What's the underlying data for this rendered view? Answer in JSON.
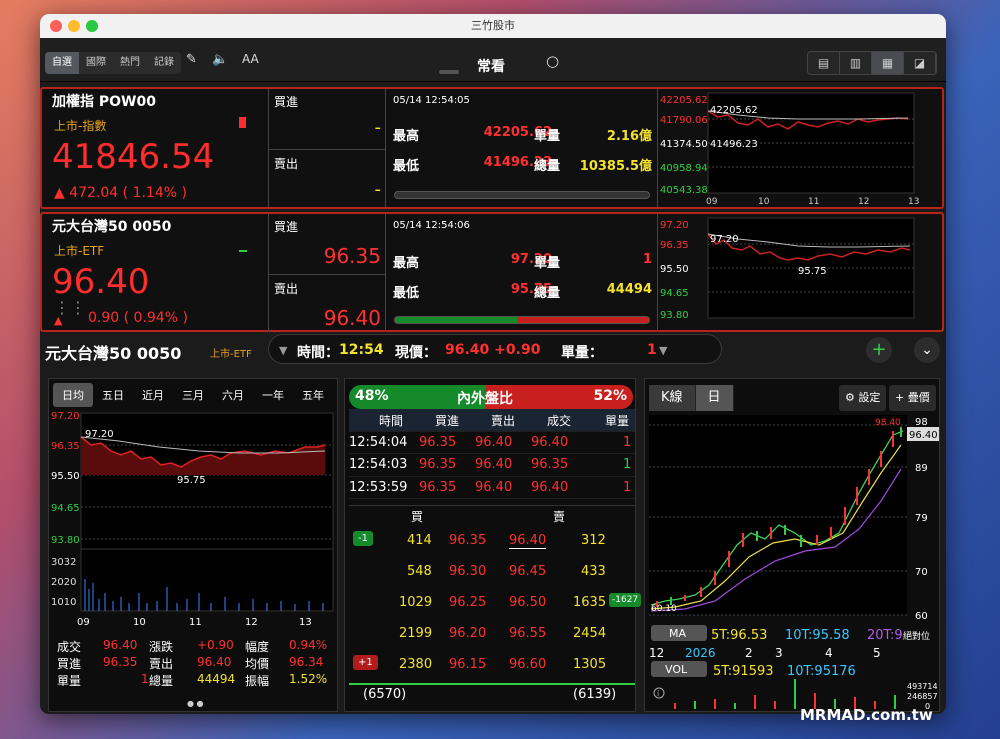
{
  "window": {
    "title": "三竹股市"
  },
  "toolbar": {
    "segments": [
      "自選",
      "國際",
      "熱門",
      "記錄"
    ],
    "center_title": "常看",
    "font_btn": "AA"
  },
  "quotes": [
    {
      "name": "加權指 POW00",
      "sub": "上市-指數",
      "price": "41846.54",
      "change": "▲  472.04  ( 1.14% )",
      "bid_label": "買進",
      "ask_label": "賣出",
      "bid": "-",
      "ask": "-",
      "time": "05/14 12:54:05",
      "high_label": "最高",
      "high": "42205.62",
      "low_label": "最低",
      "low": "41496.23",
      "unit_label": "單量",
      "unit": "2.16億",
      "total_label": "總量",
      "total": "10385.5億",
      "chart": {
        "y": [
          "42205.62",
          "41790.06",
          "41374.50",
          "40958.94",
          "40543.38"
        ],
        "hi": "42205.62",
        "mid": "41374.50",
        "lo": "41496.23",
        "x": [
          "09",
          "10",
          "11",
          "12",
          "13"
        ]
      }
    },
    {
      "name": "元大台灣50 0050",
      "sub": "上市-ETF",
      "price": "96.40",
      "change": "0.90  ( 0.94% )",
      "bid_label": "買進",
      "ask_label": "賣出",
      "bid": "96.35",
      "ask": "96.40",
      "time": "05/14 12:54:06",
      "high_label": "最高",
      "high": "97.20",
      "low_label": "最低",
      "low": "95.75",
      "unit_label": "單量",
      "unit": "1",
      "total_label": "總量",
      "total": "44494",
      "chart": {
        "y": [
          "97.20",
          "96.35",
          "95.50",
          "94.65",
          "93.80"
        ],
        "hi": "97.20",
        "mid": "95.50",
        "lo": "95.75",
        "x": [
          "09",
          "10",
          "11",
          "12",
          "13"
        ]
      }
    }
  ],
  "detail": {
    "name": "元大台灣50  0050",
    "sub": "上市-ETF",
    "time_label": "時間：",
    "time": "12:54",
    "price_label": "現價：",
    "price": "96.40 +0.90",
    "unit_label": "單量：",
    "unit": "1"
  },
  "left_panel": {
    "tabs": [
      "日均",
      "五日",
      "近月",
      "三月",
      "六月",
      "一年",
      "五年"
    ],
    "y": [
      "97.20",
      "96.35",
      "95.50",
      "94.65",
      "93.80"
    ],
    "hi": "97.20",
    "lo": "95.75",
    "vol_y": [
      "3032",
      "2020",
      "1010"
    ],
    "x": [
      "09",
      "10",
      "11",
      "12",
      "13"
    ],
    "stats": [
      [
        "成交",
        "96.40",
        "漲跌",
        "+0.90",
        "幅度",
        "0.94%"
      ],
      [
        "買進",
        "96.35",
        "賣出",
        "96.40",
        "均價",
        "96.34"
      ],
      [
        "單量",
        "1",
        "總量",
        "44494",
        "振幅",
        "1.52%"
      ]
    ]
  },
  "mid_panel": {
    "in_pct": "48%",
    "title": "內外盤比",
    "out_pct": "52%",
    "headers": [
      "時間",
      "買進",
      "賣出",
      "成交",
      "單量"
    ],
    "trades": [
      [
        "12:54:04",
        "96.35",
        "96.40",
        "96.40",
        "1"
      ],
      [
        "12:54:03",
        "96.35",
        "96.40",
        "96.35",
        "1"
      ],
      [
        "12:53:59",
        "96.35",
        "96.40",
        "96.40",
        "1"
      ]
    ],
    "book_headers": [
      "買",
      "賣"
    ],
    "book": [
      [
        "414",
        "96.35",
        "96.40",
        "312"
      ],
      [
        "548",
        "96.30",
        "96.45",
        "433"
      ],
      [
        "1029",
        "96.25",
        "96.50",
        "1635"
      ],
      [
        "2199",
        "96.20",
        "96.55",
        "2454"
      ],
      [
        "2380",
        "96.15",
        "96.60",
        "1305"
      ]
    ],
    "badges": [
      "-1",
      "-1627",
      "+1"
    ],
    "totals": [
      "(6570)",
      "(6139)"
    ]
  },
  "right_panel": {
    "tabs": [
      "K線",
      "日"
    ],
    "setting": "設定",
    "add": "疊價",
    "y": [
      "98",
      "89",
      "79",
      "70",
      "60"
    ],
    "last": "96.40",
    "hi": "98.40",
    "lo": "60.10",
    "ma_label": "MA",
    "ma_vals": [
      "5T:96.53",
      "10T:95.58",
      "20T:9"
    ],
    "abs": "絕對位",
    "months": [
      "12",
      "2026",
      "2",
      "3",
      "4",
      "5"
    ],
    "vol_label": "VOL",
    "vol_vals": [
      "5T:91593",
      "10T:95176"
    ],
    "vol_y": [
      "493714",
      "246857",
      "0"
    ]
  },
  "watermark": "MRMAD.com.tw",
  "colors": {
    "up": "#ff3030",
    "down": "#2fcf45",
    "yellow": "#f3e22e",
    "orange": "#e7a21e"
  }
}
